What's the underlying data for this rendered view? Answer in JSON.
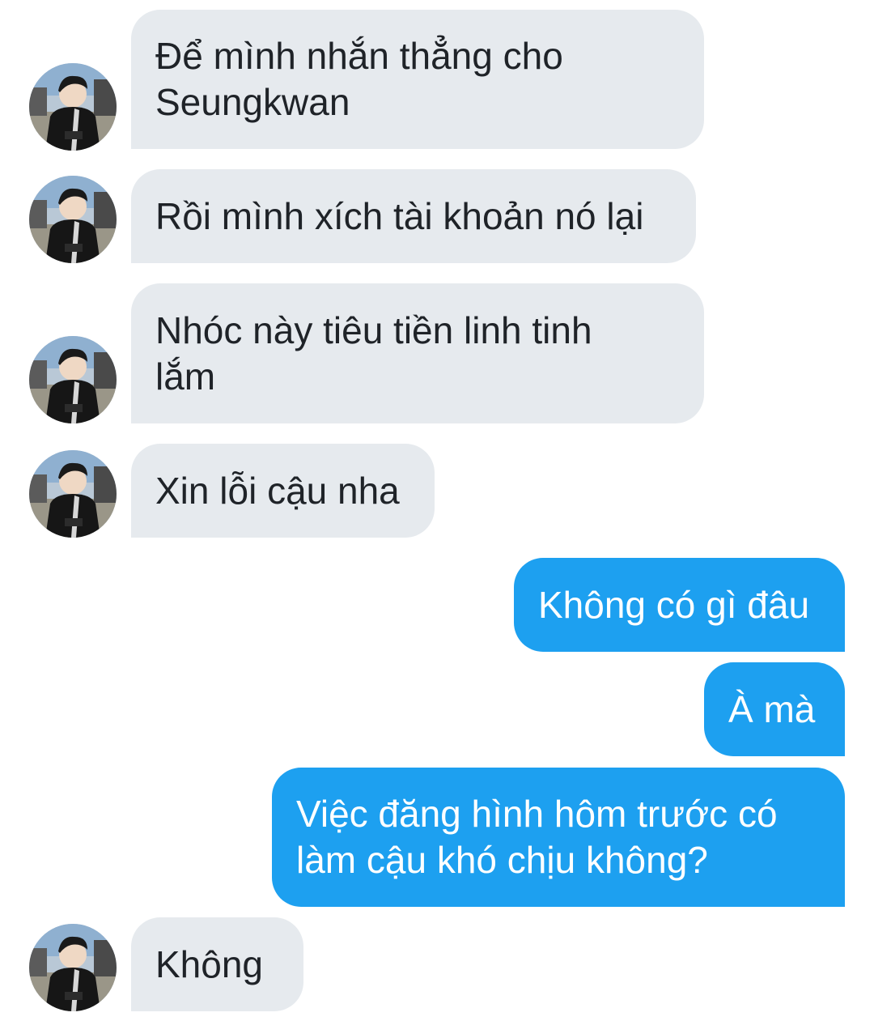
{
  "messages": [
    {
      "sender": "them",
      "text": "Để mình nhắn thẳng cho\nSeungkwan"
    },
    {
      "sender": "them",
      "text": "Rồi mình xích tài khoản nó lại"
    },
    {
      "sender": "them",
      "text": "Nhóc này tiêu tiền linh tinh\nlắm"
    },
    {
      "sender": "them",
      "text": "Xin lỗi cậu nha"
    },
    {
      "sender": "me",
      "text": "Không có gì đâu"
    },
    {
      "sender": "me",
      "text": "À mà"
    },
    {
      "sender": "me",
      "text": "Việc đăng hình hôm trước có\nlàm cậu khó chịu không?"
    },
    {
      "sender": "them",
      "text": "Không"
    }
  ],
  "colors": {
    "incoming_bubble": "#e6eaee",
    "outgoing_bubble": "#1da0f0",
    "incoming_text": "#1f2328",
    "outgoing_text": "#ffffff"
  },
  "icons": {
    "avatar": "user-avatar-photo"
  }
}
